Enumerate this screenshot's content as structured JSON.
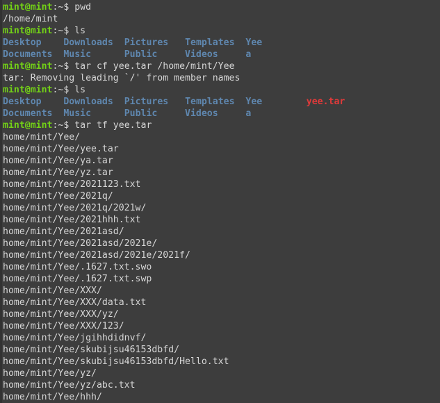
{
  "terminal": {
    "background": "#3d3d3d",
    "foreground": "#d6d6d6",
    "prompt_color": "#73d216",
    "dir_color": "#5f87af",
    "archive_color": "#e03a3a",
    "prompt_user": "mint@mint",
    "prompt_tail": ":~$ "
  },
  "commands": {
    "pwd": "pwd",
    "ls": "ls",
    "tar_create": "tar cf yee.tar /home/mint/Yee",
    "tar_list": "tar tf yee.tar"
  },
  "outputs": {
    "pwd_result": "/home/mint",
    "tar_warning": "tar: Removing leading `/' from member names"
  },
  "ls_before": {
    "rows": [
      [
        {
          "text": "Desktop",
          "type": "dir"
        },
        {
          "text": "Downloads",
          "type": "dir"
        },
        {
          "text": "Pictures",
          "type": "dir"
        },
        {
          "text": "Templates",
          "type": "dir"
        },
        {
          "text": "Yee",
          "type": "dir"
        }
      ],
      [
        {
          "text": "Documents",
          "type": "dir"
        },
        {
          "text": "Music",
          "type": "dir"
        },
        {
          "text": "Public",
          "type": "dir"
        },
        {
          "text": "Videos",
          "type": "dir"
        },
        {
          "text": "a",
          "type": "dir"
        }
      ]
    ]
  },
  "ls_after": {
    "rows": [
      [
        {
          "text": "Desktop",
          "type": "dir"
        },
        {
          "text": "Downloads",
          "type": "dir"
        },
        {
          "text": "Pictures",
          "type": "dir"
        },
        {
          "text": "Templates",
          "type": "dir"
        },
        {
          "text": "Yee",
          "type": "dir"
        },
        {
          "text": "yee.tar",
          "type": "archive"
        }
      ],
      [
        {
          "text": "Documents",
          "type": "dir"
        },
        {
          "text": "Music",
          "type": "dir"
        },
        {
          "text": "Public",
          "type": "dir"
        },
        {
          "text": "Videos",
          "type": "dir"
        },
        {
          "text": "a",
          "type": "dir"
        }
      ]
    ]
  },
  "tar_listing": [
    "home/mint/Yee/",
    "home/mint/Yee/yee.tar",
    "home/mint/Yee/ya.tar",
    "home/mint/Yee/yz.tar",
    "home/mint/Yee/2021123.txt",
    "home/mint/Yee/2021q/",
    "home/mint/Yee/2021q/2021w/",
    "home/mint/Yee/2021hhh.txt",
    "home/mint/Yee/2021asd/",
    "home/mint/Yee/2021asd/2021e/",
    "home/mint/Yee/2021asd/2021e/2021f/",
    "home/mint/Yee/.1627.txt.swo",
    "home/mint/Yee/.1627.txt.swp",
    "home/mint/Yee/XXX/",
    "home/mint/Yee/XXX/data.txt",
    "home/mint/Yee/XXX/yz/",
    "home/mint/Yee/XXX/123/",
    "home/mint/Yee/jgihhdidnvf/",
    "home/mint/Yee/skubijsu46153dbfd/",
    "home/mint/Yee/skubijsu46153dbfd/Hello.txt",
    "home/mint/Yee/yz/",
    "home/mint/Yee/yz/abc.txt",
    "home/mint/Yee/hhh/"
  ]
}
